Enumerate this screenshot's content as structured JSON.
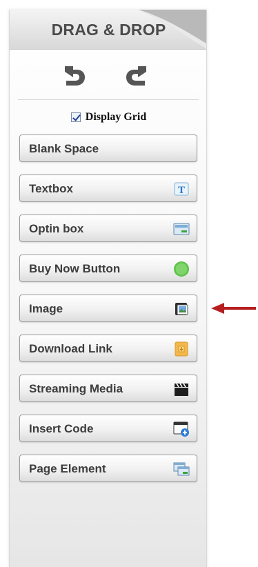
{
  "panel": {
    "title": "DRAG & DROP",
    "undo_icon": "undo-arrow-icon",
    "redo_icon": "redo-arrow-icon",
    "display_grid": {
      "label": "Display Grid",
      "checked": true
    },
    "elements": [
      {
        "key": "blank-space",
        "label": "Blank Space",
        "icon": null
      },
      {
        "key": "textbox",
        "label": "Textbox",
        "icon": "textbox-icon"
      },
      {
        "key": "optin-box",
        "label": "Optin box",
        "icon": "optin-box-icon"
      },
      {
        "key": "buy-now-button",
        "label": "Buy Now Button",
        "icon": "buy-now-icon"
      },
      {
        "key": "image",
        "label": "Image",
        "icon": "image-icon"
      },
      {
        "key": "download-link",
        "label": "Download Link",
        "icon": "download-icon"
      },
      {
        "key": "streaming-media",
        "label": "Streaming Media",
        "icon": "clapperboard-icon"
      },
      {
        "key": "insert-code",
        "label": "Insert Code",
        "icon": "insert-code-icon"
      },
      {
        "key": "page-element",
        "label": "Page Element",
        "icon": "page-element-icon"
      }
    ]
  },
  "annotation": {
    "icon": "red-arrow-icon",
    "points_to": "Image",
    "color": "#b51f1f"
  },
  "colors": {
    "button_text": "#3d3d3d",
    "title_text": "#4a4a4a",
    "arrow_red": "#b51f1f"
  }
}
